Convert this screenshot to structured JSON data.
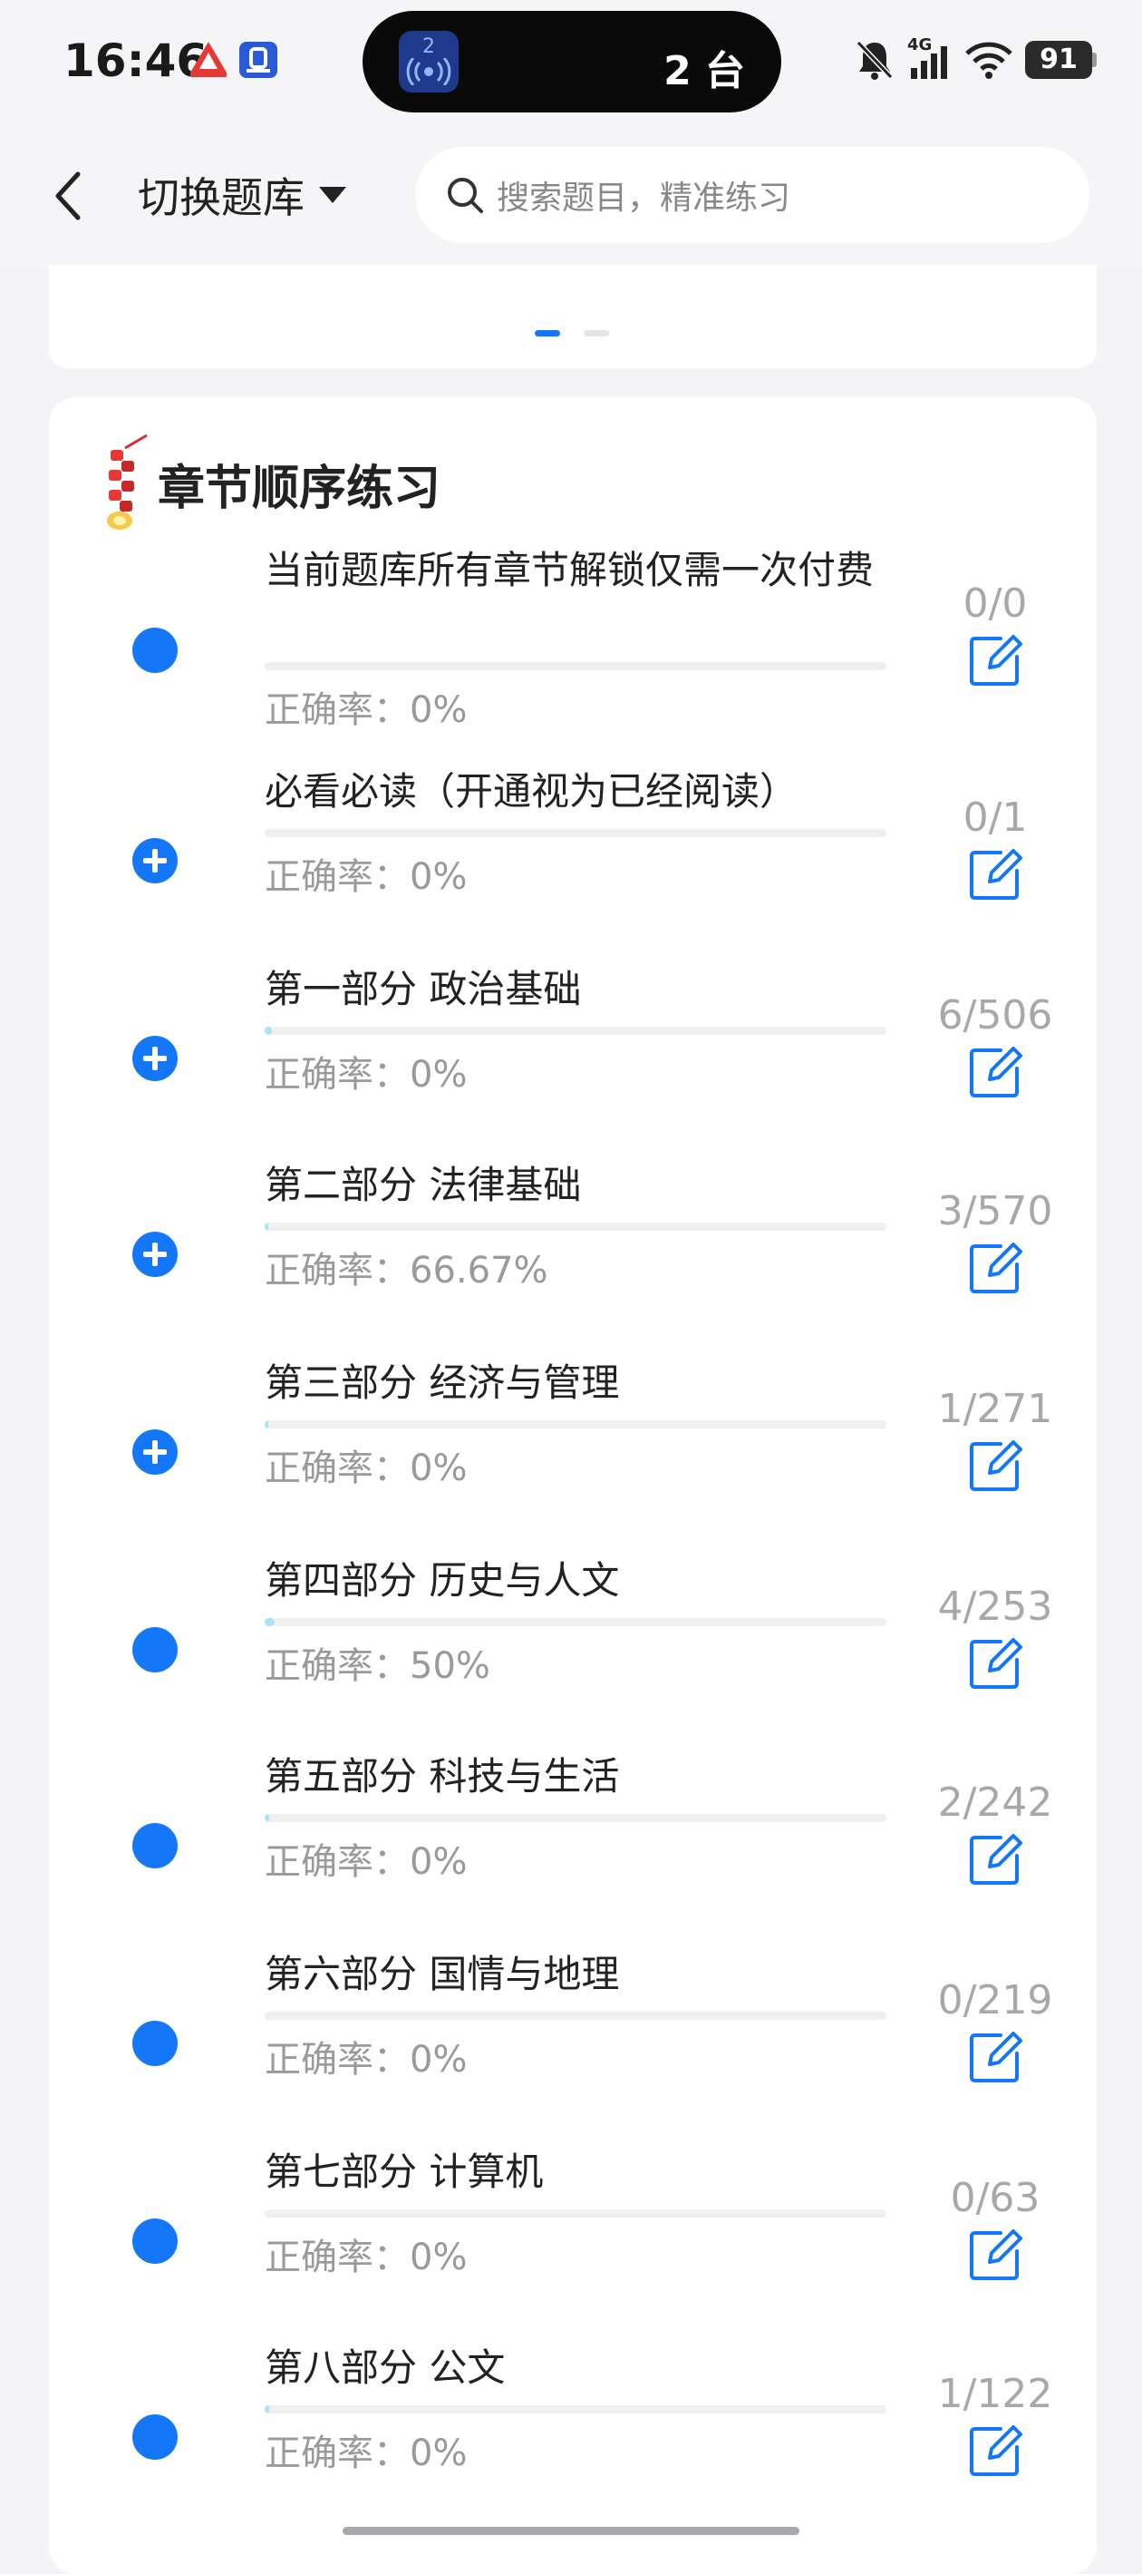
{
  "status_bar": {
    "time": "16:46",
    "island_badge": "2",
    "island_text": "2 台",
    "battery": "91",
    "network": "4G"
  },
  "header": {
    "title": "切换题库",
    "search_placeholder": "搜索题目，精准练习"
  },
  "section": {
    "title": "章节顺序练习",
    "accuracy_label": "正确率："
  },
  "chapters": [
    {
      "name": "当前题库所有章节解锁仅需一次付费",
      "count": "0/0",
      "accuracy": "正确率：0%",
      "marker": "dot",
      "progress": 0
    },
    {
      "name": "必看必读（开通视为已经阅读）",
      "count": "0/1",
      "accuracy": "正确率：0%",
      "marker": "plus",
      "progress": 0
    },
    {
      "name": "第一部分 政治基础",
      "count": "6/506",
      "accuracy": "正确率：0%",
      "marker": "plus",
      "progress": 0.012
    },
    {
      "name": "第二部分 法律基础",
      "count": "3/570",
      "accuracy": "正确率：66.67%",
      "marker": "plus",
      "progress": 0.005
    },
    {
      "name": "第三部分 经济与管理",
      "count": "1/271",
      "accuracy": "正确率：0%",
      "marker": "plus",
      "progress": 0.004
    },
    {
      "name": "第四部分 历史与人文",
      "count": "4/253",
      "accuracy": "正确率：50%",
      "marker": "dot",
      "progress": 0.016
    },
    {
      "name": "第五部分 科技与生活",
      "count": "2/242",
      "accuracy": "正确率：0%",
      "marker": "dot",
      "progress": 0.008
    },
    {
      "name": "第六部分 国情与地理",
      "count": "0/219",
      "accuracy": "正确率：0%",
      "marker": "dot",
      "progress": 0
    },
    {
      "name": "第七部分 计算机",
      "count": "0/63",
      "accuracy": "正确率：0%",
      "marker": "dot",
      "progress": 0
    },
    {
      "name": "第八部分 公文",
      "count": "1/122",
      "accuracy": "正确率：0%",
      "marker": "dot",
      "progress": 0.008
    }
  ],
  "colors": {
    "accent": "#1477f8",
    "progress_fill": "#a8e3f6",
    "muted_text": "#9a9a9a"
  },
  "icons": {
    "back": "back-chevron-icon",
    "dropdown": "dropdown-triangle-icon",
    "search": "search-icon",
    "edit": "edit-icon",
    "firecracker": "firecracker-icon"
  }
}
